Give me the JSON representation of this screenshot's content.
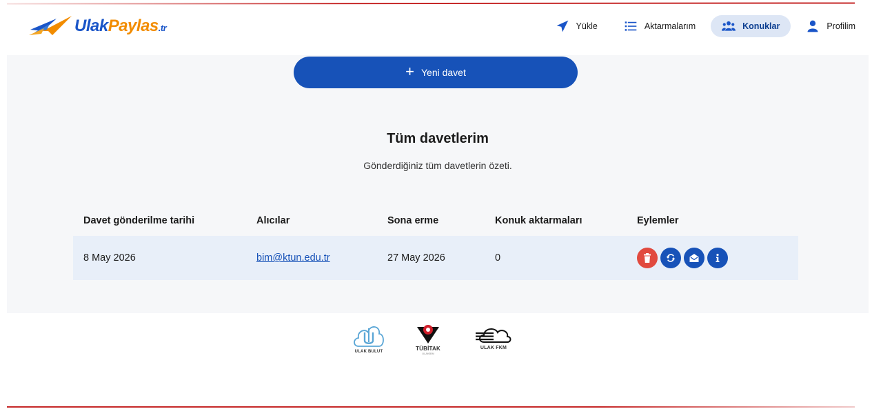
{
  "brand": {
    "ulak": "Ulak",
    "paylas": "Paylas",
    "tr": ".tr"
  },
  "nav": {
    "upload": {
      "label": "Yükle",
      "icon": "paper-plane-icon"
    },
    "transfers": {
      "label": "Aktarmalarım",
      "icon": "list-icon"
    },
    "guests": {
      "label": "Konuklar",
      "icon": "users-icon",
      "active": true
    },
    "profile": {
      "label": "Profilim",
      "icon": "user-icon"
    }
  },
  "new_invite": {
    "label": "Yeni davet",
    "icon": "plus-icon"
  },
  "section": {
    "title": "Tüm davetlerim",
    "subtitle": "Gönderdiğiniz tüm davetlerin özeti."
  },
  "table": {
    "headers": [
      "Davet gönderilme tarihi",
      "Alıcılar",
      "Sona erme",
      "Konuk aktarmaları",
      "Eylemler"
    ],
    "rows": [
      {
        "sent": "8 May 2026",
        "recipient": "bim@ktun.edu.tr",
        "expires": "27 May 2026",
        "transfers": "0",
        "actions": [
          "trash-icon",
          "sync-icon",
          "envelope-open-icon",
          "info-icon"
        ]
      }
    ]
  },
  "footer": {
    "logos": [
      {
        "name": "ulak-bulut-logo",
        "caption": "ULAK BULUT"
      },
      {
        "name": "tubitak-logo",
        "caption": "TÜBİTAK",
        "sub": "ULAKBİM"
      },
      {
        "name": "ulak-fkm-logo",
        "caption": "ULAK FKM"
      }
    ]
  },
  "colors": {
    "primary": "#1752b8",
    "accent": "#f28c00",
    "danger": "#e14a3f",
    "row_bg": "#e8eff9",
    "line": "#c62828"
  }
}
